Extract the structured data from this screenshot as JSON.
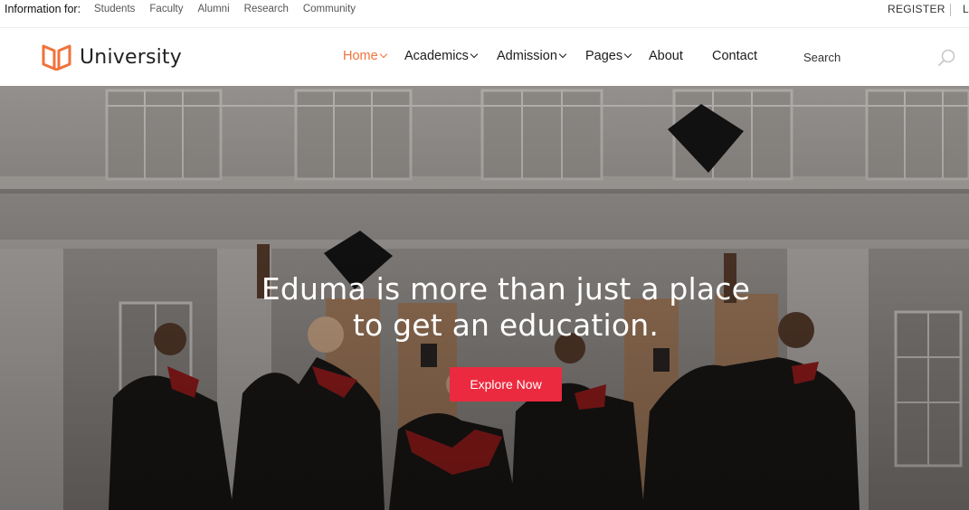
{
  "topbar": {
    "info_label": "Information for:",
    "links": [
      "Students",
      "Faculty",
      "Alumni",
      "Research",
      "Community"
    ],
    "register": "REGISTER",
    "login": "L"
  },
  "header": {
    "logo_text": "University",
    "logo_icon": "open-book-icon",
    "nav": [
      {
        "label": "Home",
        "dropdown": true,
        "active": true
      },
      {
        "label": "Academics",
        "dropdown": true,
        "active": false
      },
      {
        "label": "Admission",
        "dropdown": true,
        "active": false
      },
      {
        "label": "Pages",
        "dropdown": true,
        "active": false
      },
      {
        "label": "About",
        "dropdown": false,
        "active": false
      },
      {
        "label": "Contact",
        "dropdown": false,
        "active": false
      }
    ],
    "search_placeholder": "Search",
    "search_icon": "search-icon"
  },
  "hero": {
    "title_line1": "Eduma is more than just a place",
    "title_line2": "to get an education.",
    "cta_label": "Explore Now"
  },
  "colors": {
    "accent": "#f0723a",
    "cta": "#ec2a3f",
    "text": "#1c1c1c"
  }
}
